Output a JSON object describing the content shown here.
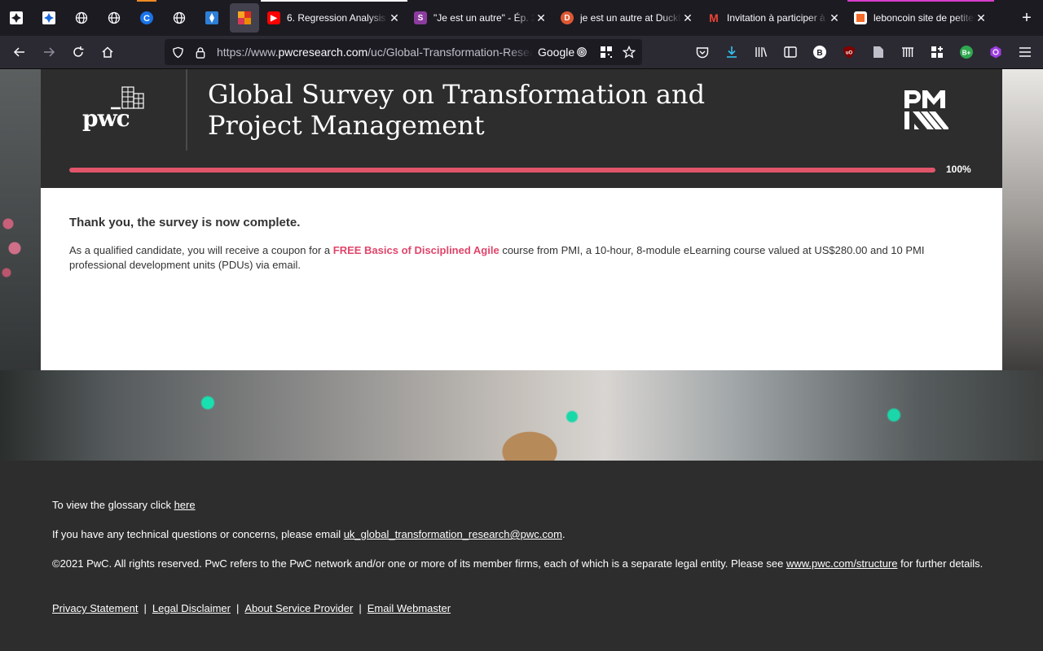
{
  "browser": {
    "pinned_tabs": [
      {
        "icon": "confluence-icon",
        "color": "#1868db"
      },
      {
        "icon": "confluence-icon",
        "color": "#1868db"
      },
      {
        "icon": "globe-icon",
        "color": "#fbfbfe"
      },
      {
        "icon": "globe-icon",
        "color": "#fbfbfe"
      },
      {
        "icon": "c-app-icon",
        "color": "#1a73e8",
        "indicator": "#f08a24"
      },
      {
        "icon": "globe-icon",
        "color": "#fbfbfe"
      },
      {
        "icon": "jira-icon",
        "color": "#2d7fd6"
      },
      {
        "icon": "pwc-favicon-icon",
        "color": "#e0301e",
        "active": true
      }
    ],
    "tabs": [
      {
        "title": "6. Regression Analysis -",
        "icon": "youtube-icon",
        "color": "#ff0000",
        "indicator": "#fbfbfe"
      },
      {
        "title": "\"Je est un autre\" - Ép. 2",
        "icon": "podcast-icon",
        "color": "#8c3c9e"
      },
      {
        "title": "je est un autre at DuckD",
        "icon": "duckduckgo-icon",
        "color": "#de5833"
      },
      {
        "title": "Invitation à participer à",
        "icon": "gmail-icon",
        "color": "#ea4335"
      },
      {
        "title": "leboncoin site de petites",
        "icon": "leboncoin-icon",
        "color": "#f56b2a",
        "indicator": "#d83ccb"
      }
    ],
    "url_prefix": "https://www.",
    "url_domain": "pwcresearch.com",
    "url_path": "/uc/Global-Transformation-Research",
    "search_engine": "Google"
  },
  "header": {
    "title": "Global Survey on Transformation and Project Management",
    "logo_text": "pwc",
    "progress_percent": 100,
    "progress_label": "100%",
    "accent_color": "#e0556a"
  },
  "main": {
    "heading": "Thank you, the survey is now complete.",
    "message_pre": "As a qualified candidate, you will receive a coupon for a ",
    "message_highlight": "FREE Basics of Disciplined Agile",
    "message_post": " course from PMI, a 10-hour, 8-module eLearning course valued at US$280.00 and 10 PMI professional development units (PDUs) via email."
  },
  "footer": {
    "glossary_pre": "To view the glossary click ",
    "glossary_link": "here",
    "contact_pre": "If you have any technical questions or concerns, please email ",
    "contact_email": "uk_global_transformation_research@pwc.com",
    "contact_post": ".",
    "copyright_pre": "©2021 PwC. All rights reserved. PwC refers to the PwC network and/or one or more of its member firms, each of which is a separate legal entity. Please see ",
    "copyright_link": "www.pwc.com/structure",
    "copyright_post": " for further details.",
    "links": [
      "Privacy Statement",
      "Legal Disclaimer",
      "About Service Provider",
      "Email Webmaster"
    ],
    "link_separator": "|"
  }
}
